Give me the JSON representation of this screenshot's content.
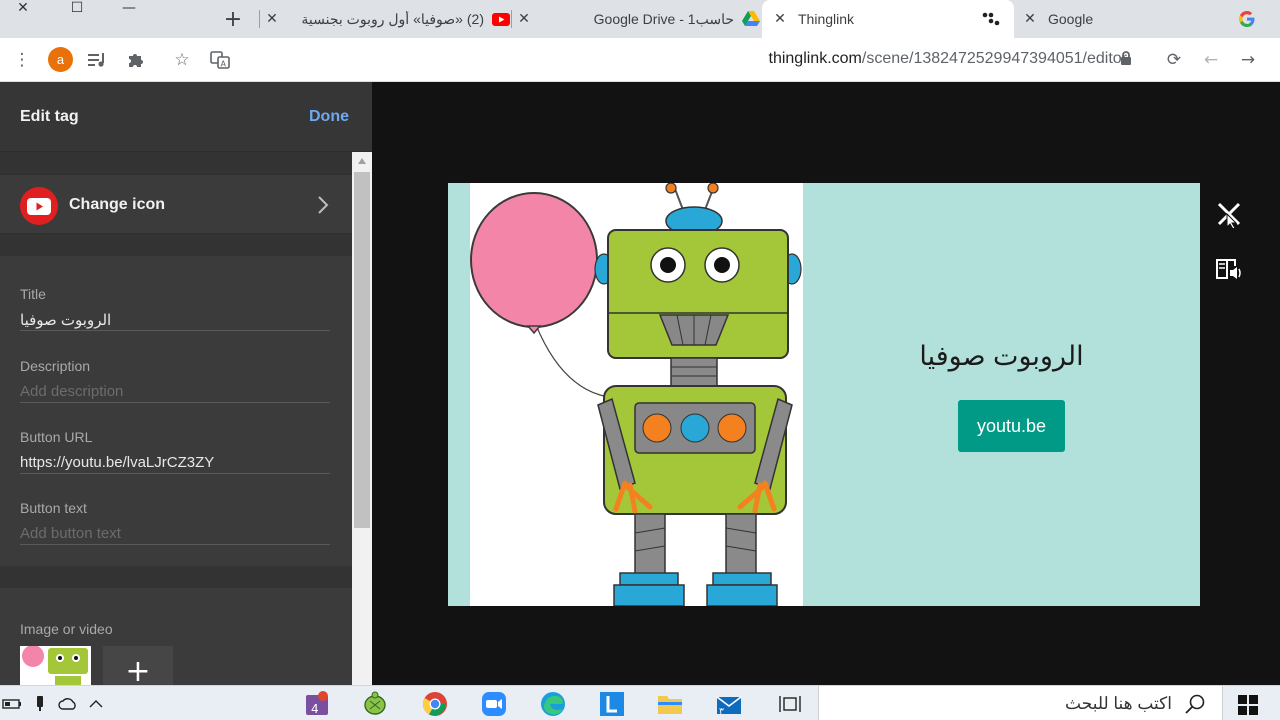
{
  "browser": {
    "tabs": [
      {
        "title": "Google",
        "favicon": "google-g-icon",
        "active": false
      },
      {
        "title": "Thinglink",
        "favicon": "thinglink-dots-icon",
        "active": true
      },
      {
        "title": "حاسب1 - Google Drive",
        "favicon": "google-drive-icon",
        "active": false
      },
      {
        "title": "(2) «صوفيا» أول روبوت بجنسية",
        "favicon": "youtube-icon",
        "active": false
      }
    ],
    "url_host": "thinglink.com",
    "url_path": "/scene/1382472529947394051/editor",
    "avatar_letter": "a"
  },
  "panel": {
    "title": "Edit tag",
    "done_label": "Done",
    "change_icon_label": "Change icon",
    "fields": {
      "title_label": "Title",
      "title_value": "الروبوت صوفيا",
      "description_label": "Description",
      "description_placeholder": "Add description",
      "url_label": "Button URL",
      "url_value": "https://youtu.be/lvaLJrCZ3ZY",
      "button_text_label": "Button text",
      "button_text_placeholder": "Add button text"
    },
    "media_label": "Image or video",
    "add_media_symbol": "+"
  },
  "card": {
    "title": "الروبوت صوفيا",
    "button_label": "youtu.be"
  },
  "taskbar": {
    "search_placeholder": "اكتب هنا للبحث"
  },
  "colors": {
    "card_bg": "#b2e1dc",
    "card_button": "#009a87",
    "done_link": "#6ea8f0",
    "youtube_red": "#e02020"
  }
}
